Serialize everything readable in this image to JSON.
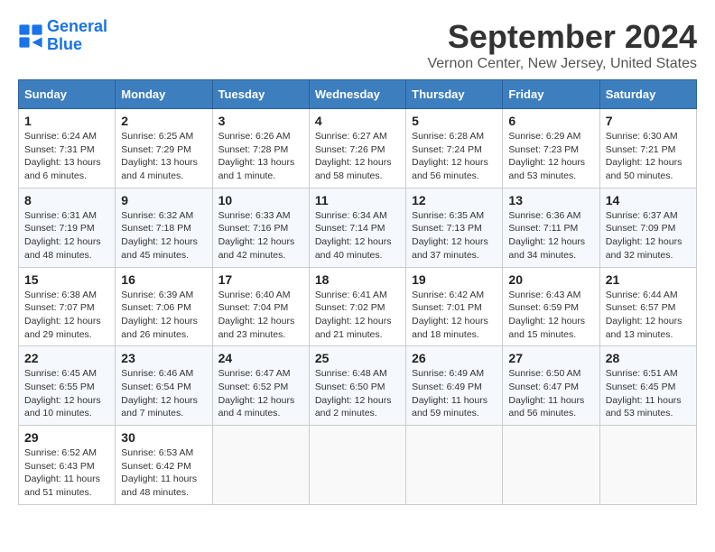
{
  "header": {
    "logo_line1": "General",
    "logo_line2": "Blue",
    "month": "September 2024",
    "location": "Vernon Center, New Jersey, United States"
  },
  "days_of_week": [
    "Sunday",
    "Monday",
    "Tuesday",
    "Wednesday",
    "Thursday",
    "Friday",
    "Saturday"
  ],
  "weeks": [
    [
      {
        "day": "1",
        "info": "Sunrise: 6:24 AM\nSunset: 7:31 PM\nDaylight: 13 hours and 6 minutes."
      },
      {
        "day": "2",
        "info": "Sunrise: 6:25 AM\nSunset: 7:29 PM\nDaylight: 13 hours and 4 minutes."
      },
      {
        "day": "3",
        "info": "Sunrise: 6:26 AM\nSunset: 7:28 PM\nDaylight: 13 hours and 1 minute."
      },
      {
        "day": "4",
        "info": "Sunrise: 6:27 AM\nSunset: 7:26 PM\nDaylight: 12 hours and 58 minutes."
      },
      {
        "day": "5",
        "info": "Sunrise: 6:28 AM\nSunset: 7:24 PM\nDaylight: 12 hours and 56 minutes."
      },
      {
        "day": "6",
        "info": "Sunrise: 6:29 AM\nSunset: 7:23 PM\nDaylight: 12 hours and 53 minutes."
      },
      {
        "day": "7",
        "info": "Sunrise: 6:30 AM\nSunset: 7:21 PM\nDaylight: 12 hours and 50 minutes."
      }
    ],
    [
      {
        "day": "8",
        "info": "Sunrise: 6:31 AM\nSunset: 7:19 PM\nDaylight: 12 hours and 48 minutes."
      },
      {
        "day": "9",
        "info": "Sunrise: 6:32 AM\nSunset: 7:18 PM\nDaylight: 12 hours and 45 minutes."
      },
      {
        "day": "10",
        "info": "Sunrise: 6:33 AM\nSunset: 7:16 PM\nDaylight: 12 hours and 42 minutes."
      },
      {
        "day": "11",
        "info": "Sunrise: 6:34 AM\nSunset: 7:14 PM\nDaylight: 12 hours and 40 minutes."
      },
      {
        "day": "12",
        "info": "Sunrise: 6:35 AM\nSunset: 7:13 PM\nDaylight: 12 hours and 37 minutes."
      },
      {
        "day": "13",
        "info": "Sunrise: 6:36 AM\nSunset: 7:11 PM\nDaylight: 12 hours and 34 minutes."
      },
      {
        "day": "14",
        "info": "Sunrise: 6:37 AM\nSunset: 7:09 PM\nDaylight: 12 hours and 32 minutes."
      }
    ],
    [
      {
        "day": "15",
        "info": "Sunrise: 6:38 AM\nSunset: 7:07 PM\nDaylight: 12 hours and 29 minutes."
      },
      {
        "day": "16",
        "info": "Sunrise: 6:39 AM\nSunset: 7:06 PM\nDaylight: 12 hours and 26 minutes."
      },
      {
        "day": "17",
        "info": "Sunrise: 6:40 AM\nSunset: 7:04 PM\nDaylight: 12 hours and 23 minutes."
      },
      {
        "day": "18",
        "info": "Sunrise: 6:41 AM\nSunset: 7:02 PM\nDaylight: 12 hours and 21 minutes."
      },
      {
        "day": "19",
        "info": "Sunrise: 6:42 AM\nSunset: 7:01 PM\nDaylight: 12 hours and 18 minutes."
      },
      {
        "day": "20",
        "info": "Sunrise: 6:43 AM\nSunset: 6:59 PM\nDaylight: 12 hours and 15 minutes."
      },
      {
        "day": "21",
        "info": "Sunrise: 6:44 AM\nSunset: 6:57 PM\nDaylight: 12 hours and 13 minutes."
      }
    ],
    [
      {
        "day": "22",
        "info": "Sunrise: 6:45 AM\nSunset: 6:55 PM\nDaylight: 12 hours and 10 minutes."
      },
      {
        "day": "23",
        "info": "Sunrise: 6:46 AM\nSunset: 6:54 PM\nDaylight: 12 hours and 7 minutes."
      },
      {
        "day": "24",
        "info": "Sunrise: 6:47 AM\nSunset: 6:52 PM\nDaylight: 12 hours and 4 minutes."
      },
      {
        "day": "25",
        "info": "Sunrise: 6:48 AM\nSunset: 6:50 PM\nDaylight: 12 hours and 2 minutes."
      },
      {
        "day": "26",
        "info": "Sunrise: 6:49 AM\nSunset: 6:49 PM\nDaylight: 11 hours and 59 minutes."
      },
      {
        "day": "27",
        "info": "Sunrise: 6:50 AM\nSunset: 6:47 PM\nDaylight: 11 hours and 56 minutes."
      },
      {
        "day": "28",
        "info": "Sunrise: 6:51 AM\nSunset: 6:45 PM\nDaylight: 11 hours and 53 minutes."
      }
    ],
    [
      {
        "day": "29",
        "info": "Sunrise: 6:52 AM\nSunset: 6:43 PM\nDaylight: 11 hours and 51 minutes."
      },
      {
        "day": "30",
        "info": "Sunrise: 6:53 AM\nSunset: 6:42 PM\nDaylight: 11 hours and 48 minutes."
      },
      {
        "day": "",
        "info": ""
      },
      {
        "day": "",
        "info": ""
      },
      {
        "day": "",
        "info": ""
      },
      {
        "day": "",
        "info": ""
      },
      {
        "day": "",
        "info": ""
      }
    ]
  ]
}
